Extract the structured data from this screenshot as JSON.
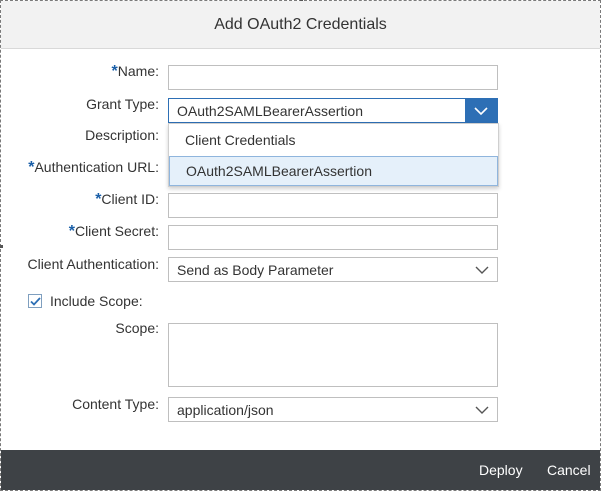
{
  "dialog": {
    "title": "Add OAuth2 Credentials"
  },
  "form": {
    "required_marker": "*",
    "name": {
      "label": "Name:",
      "value": ""
    },
    "grant_type": {
      "label": "Grant Type:",
      "value": "OAuth2SAMLBearerAssertion",
      "options": [
        "Client Credentials",
        "OAuth2SAMLBearerAssertion"
      ],
      "selected_index": 1
    },
    "description": {
      "label": "Description:",
      "value": ""
    },
    "authentication_url": {
      "label": "Authentication URL:",
      "value": ""
    },
    "client_id": {
      "label": "Client ID:",
      "value": ""
    },
    "client_secret": {
      "label": "Client Secret:",
      "value": ""
    },
    "client_authentication": {
      "label": "Client Authentication:",
      "value": "Send as Body Parameter"
    },
    "include_scope": {
      "label": "Include Scope:",
      "checked": true
    },
    "scope": {
      "label": "Scope:",
      "value": ""
    },
    "content_type": {
      "label": "Content Type:",
      "value": "application/json"
    }
  },
  "footer": {
    "deploy_label": "Deploy",
    "cancel_label": "Cancel"
  },
  "colors": {
    "accent": "#2d6fb5",
    "footer_bg": "#3e4246",
    "header_bg": "#f2f2f2",
    "selected_bg": "#e5f0fa"
  },
  "icons": {
    "dropdown": "chevron-down-icon",
    "checkbox": "checkmark-icon"
  }
}
